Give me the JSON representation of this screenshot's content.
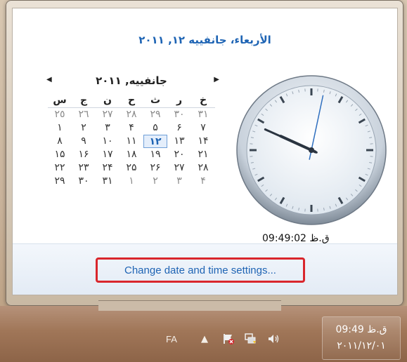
{
  "popup": {
    "date_title": "الأربعاء، جانفييه ١٢, ٢٠١١",
    "change_link": "Change date and time settings...",
    "time": "ق.ظ 09:49:02"
  },
  "calendar": {
    "month_title": "جانفييه, ٢٠١١",
    "prev_icon": "triangle-left-icon",
    "next_icon": "triangle-right-icon",
    "weekdays": [
      "س",
      "ج",
      "ن",
      "ح",
      "ث",
      "ر",
      "خ",
      "ج"
    ],
    "weeks": [
      [
        "٢٥",
        "٢٦",
        "٢٧",
        "٢٨",
        "٢٩",
        "٣٠",
        "٣١"
      ],
      [
        "١",
        "٢",
        "٣",
        "۴",
        "۵",
        "۶",
        "٧"
      ],
      [
        "٨",
        "٩",
        "١٠",
        "١١",
        "١٢",
        "١٣",
        "١۴"
      ],
      [
        "١۵",
        "١۶",
        "١٧",
        "١٨",
        "١٩",
        "٢٠",
        "٢١"
      ],
      [
        "٢٢",
        "٢٣",
        "٢۴",
        "٢۵",
        "٢۶",
        "٢٧",
        "٢٨"
      ],
      [
        "٢٩",
        "٣٠",
        "٣١",
        "١",
        "٢",
        "٣",
        "۴"
      ]
    ],
    "selected": "١٢"
  },
  "clock": {
    "hours": 9,
    "minutes": 49,
    "seconds": 2
  },
  "taskbar": {
    "language": "FA",
    "time": "ق.ظ 09:49",
    "date": "٢٠١١/١٢/٠١",
    "icons": [
      "show-hidden-icons-icon",
      "action-center-flag-icon",
      "network-icon",
      "volume-icon"
    ]
  },
  "colors": {
    "accent": "#1e64b4",
    "highlight_border": "#d9262c"
  }
}
